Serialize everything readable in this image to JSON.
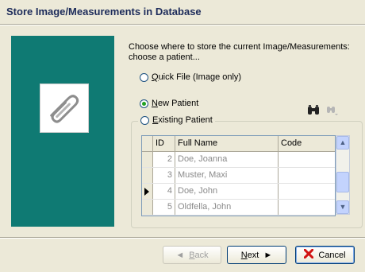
{
  "window": {
    "title": "Store Image/Measurements in Database"
  },
  "intro": {
    "line1": "Choose where to store the current Image/Measurements:",
    "line2": "choose a patient..."
  },
  "options": {
    "quick_file": {
      "label": "Quick File (Image only)",
      "checked": false
    },
    "new_patient": {
      "label": "New Patient",
      "checked": true
    },
    "existing_patient": {
      "label": "Existing Patient",
      "checked": false
    }
  },
  "icons": {
    "left_panel": "paperclip-icon",
    "search": "binoculars-icon",
    "search_next": "binoculars-next-icon"
  },
  "grid": {
    "columns": [
      "ID",
      "Full Name",
      "Code"
    ],
    "rows": [
      {
        "id": "2",
        "name": "Doe, Joanna",
        "code": ""
      },
      {
        "id": "3",
        "name": "Muster, Maxi",
        "code": ""
      },
      {
        "id": "4",
        "name": "Doe, John",
        "code": "",
        "current": true
      },
      {
        "id": "5",
        "name": "Oldfella, John",
        "code": ""
      }
    ]
  },
  "buttons": {
    "back": {
      "label": "Back",
      "arrow": "◄",
      "enabled": false
    },
    "next": {
      "label": "Next",
      "arrow": "►",
      "enabled": true
    },
    "cancel": {
      "label": "Cancel",
      "icon": "red-x-icon",
      "enabled": true
    }
  },
  "colors": {
    "panel": "#0f7a73",
    "window_bg": "#ece9d8",
    "title_text": "#1c2b5a"
  }
}
